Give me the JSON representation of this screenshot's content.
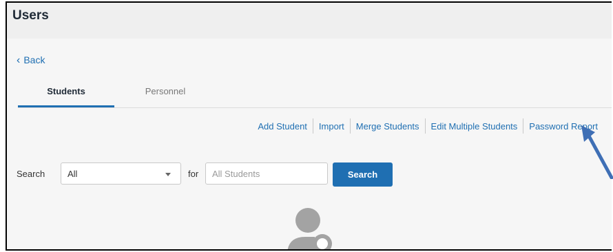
{
  "page": {
    "title": "Users",
    "back_label": "Back"
  },
  "tabs": [
    {
      "label": "Students",
      "active": true
    },
    {
      "label": "Personnel",
      "active": false
    }
  ],
  "actions": [
    {
      "label": "Add Student"
    },
    {
      "label": "Import"
    },
    {
      "label": "Merge Students"
    },
    {
      "label": "Edit Multiple Students"
    },
    {
      "label": "Password Report"
    }
  ],
  "search": {
    "label": "Search",
    "scope_value": "All",
    "for_label": "for",
    "placeholder": "All Students",
    "button_label": "Search"
  },
  "icons": {
    "back": "chevron-left-icon",
    "dropdown": "caret-down-icon",
    "empty_state": "user-search-icon",
    "annotation": "arrow-annotation-icon"
  },
  "colors": {
    "accent": "#1f6fb2",
    "annotation_arrow": "#3f6fb5"
  }
}
